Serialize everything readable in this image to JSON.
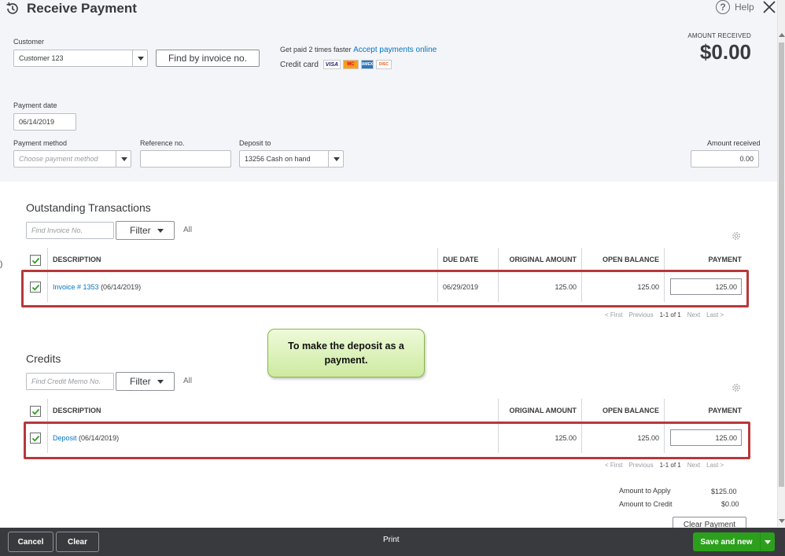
{
  "header": {
    "title": "Receive Payment",
    "help_label": "Help"
  },
  "customer": {
    "label": "Customer",
    "value": "Customer 123",
    "find_button": "Find by invoice no."
  },
  "promo": {
    "text": "Get paid 2 times faster",
    "link": "Accept payments online",
    "credit_card_label": "Credit card",
    "cards": [
      "VISA",
      "MC",
      "AMEX",
      "DISC"
    ]
  },
  "amount_received_header": {
    "label": "AMOUNT RECEIVED",
    "value": "$0.00"
  },
  "payment_date": {
    "label": "Payment date",
    "value": "06/14/2019"
  },
  "payment_method": {
    "label": "Payment method",
    "placeholder": "Choose payment method"
  },
  "reference_no": {
    "label": "Reference no.",
    "value": ""
  },
  "deposit_to": {
    "label": "Deposit to",
    "value": "13256 Cash on hand"
  },
  "amount_received_field": {
    "label": "Amount received",
    "value": "0.00"
  },
  "outstanding": {
    "title": "Outstanding Transactions",
    "search_placeholder": "Find Invoice No.",
    "filter_label": "Filter",
    "all_label": "All",
    "columns": [
      "DESCRIPTION",
      "DUE DATE",
      "ORIGINAL AMOUNT",
      "OPEN BALANCE",
      "PAYMENT"
    ],
    "rows": [
      {
        "link": "Invoice # 1353",
        "date": "(06/14/2019)",
        "due_date": "06/29/2019",
        "original": "125.00",
        "open": "125.00",
        "payment": "125.00"
      }
    ],
    "pager": {
      "first": "< First",
      "previous": "Previous",
      "range": "1-1 of 1",
      "next": "Next",
      "last": "Last >"
    }
  },
  "credits": {
    "title": "Credits",
    "search_placeholder": "Find Credit Memo No.",
    "filter_label": "Filter",
    "all_label": "All",
    "columns": [
      "DESCRIPTION",
      "ORIGINAL AMOUNT",
      "OPEN BALANCE",
      "PAYMENT"
    ],
    "rows": [
      {
        "link": "Deposit",
        "date": "(06/14/2019)",
        "original": "125.00",
        "open": "125.00",
        "payment": "125.00"
      }
    ],
    "pager": {
      "first": "< First",
      "previous": "Previous",
      "range": "1-1 of 1",
      "next": "Next",
      "last": "Last >"
    }
  },
  "callout": {
    "text": "To make the deposit as a payment."
  },
  "totals": {
    "apply_label": "Amount to Apply",
    "apply_value": "$125.00",
    "credit_label": "Amount to Credit",
    "credit_value": "$0.00",
    "clear_payment": "Clear Payment"
  },
  "footer": {
    "cancel": "Cancel",
    "clear": "Clear",
    "print": "Print",
    "save": "Save and new"
  },
  "colors": {
    "accent_green": "#2ca01c",
    "link_blue": "#0077c5",
    "highlight_red": "#b8383a",
    "footer_bg": "#393a3d"
  }
}
